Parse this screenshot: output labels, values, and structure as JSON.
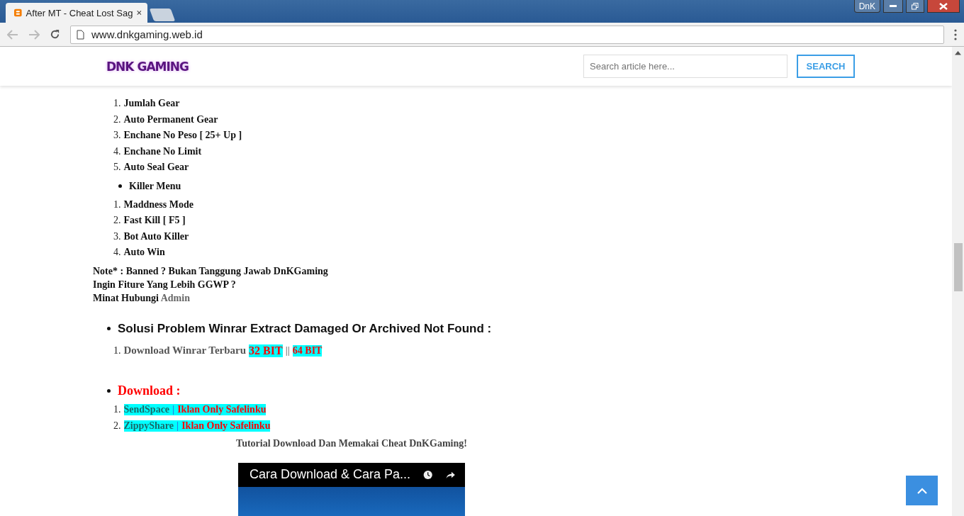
{
  "browser": {
    "tab_title": "After MT - Cheat Lost Sag",
    "profile": "DnK",
    "url": "www.dnkgaming.web.id"
  },
  "header": {
    "logo": "DNK GAMING",
    "search_placeholder": "Search article here...",
    "search_button": "SEARCH"
  },
  "gear_items": [
    {
      "number": "1.",
      "text": "Jumlah Gear"
    },
    {
      "number": "2.",
      "text": "Auto Permanent Gear"
    },
    {
      "number": "3.",
      "text": "Enchane No Peso [ 25+ Up ]"
    },
    {
      "number": "4.",
      "text": "Enchane No Limit"
    },
    {
      "number": "5.",
      "text": "Auto Seal Gear"
    }
  ],
  "killer_menu": {
    "title": "Killer Menu",
    "items": [
      {
        "number": "1.",
        "text": "Maddness Mode"
      },
      {
        "number": "2.",
        "text": "Fast Kill [ F5 ]"
      },
      {
        "number": "3.",
        "text": "Bot Auto Killer"
      },
      {
        "number": "4.",
        "text": "Auto Win"
      }
    ]
  },
  "notes": [
    "Note* : Banned ? Bukan Tanggung Jawab DnKGaming",
    "Ingin Fiture Yang Lebih GGWP ?"
  ],
  "contact": {
    "text": "Minat Hubungi",
    "link": "Admin"
  },
  "winrar": {
    "heading": "Solusi Problem Winrar Extract Damaged Or Archived Not Found :",
    "number": "1.",
    "text": "Download Winrar Terbaru",
    "link_32": "32 BIT",
    "separator": "||",
    "link_64": "64 BIT"
  },
  "download": {
    "heading": "Download :",
    "items": [
      {
        "number": "1.",
        "host": "SendSpace",
        "separator": "|",
        "note": "Iklan Only Safelinku"
      },
      {
        "number": "2.",
        "host": "ZippyShare",
        "separator": "|",
        "note": "Iklan Only Safelinku"
      }
    ]
  },
  "video": {
    "caption": "Tutorial Download Dan Memakai Cheat DnKGaming!",
    "title": "Cara Download & Cara Pa..."
  }
}
